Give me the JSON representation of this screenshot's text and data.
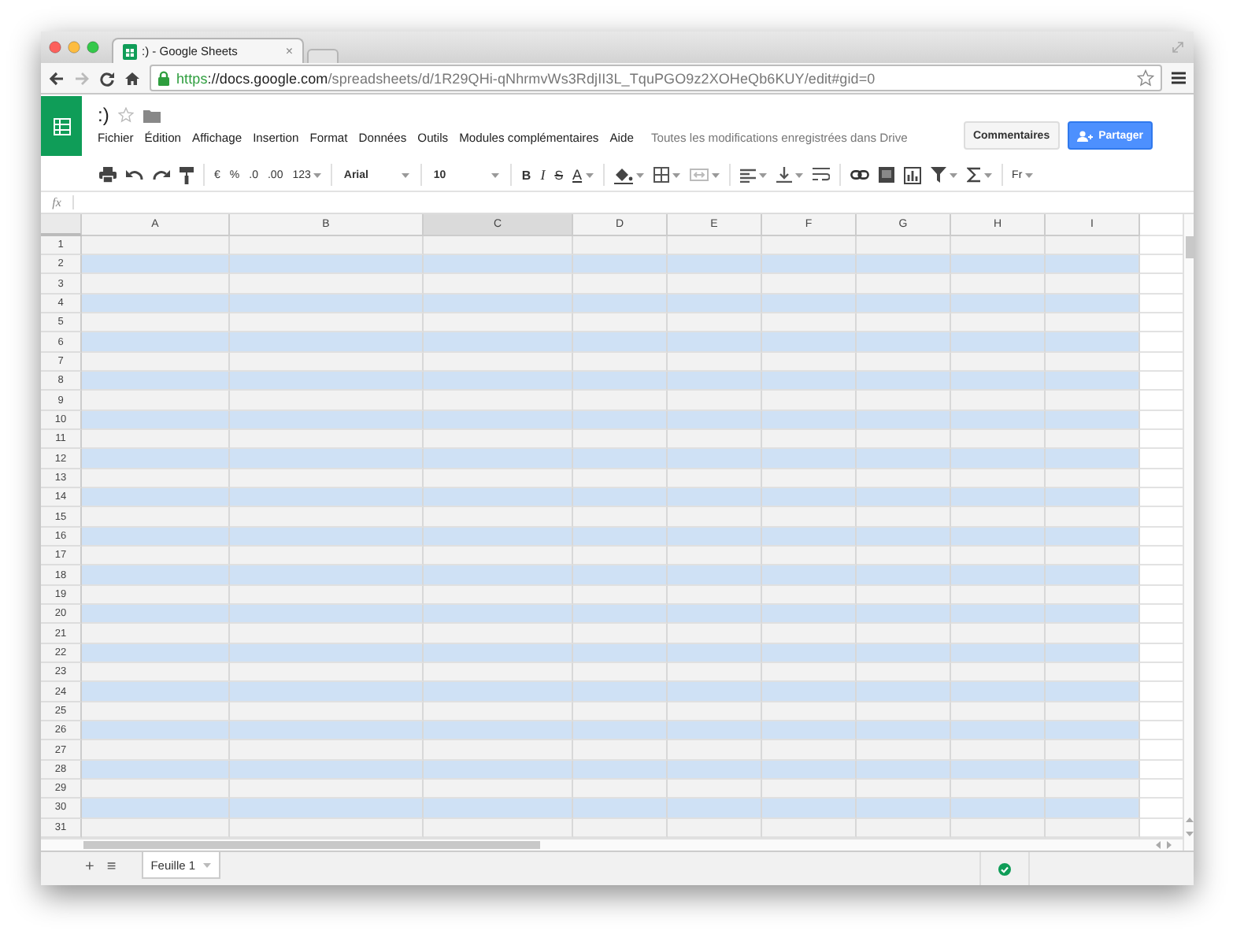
{
  "browser": {
    "tab_title": ":) - Google Sheets",
    "tab_close": "×",
    "url": {
      "scheme": "https",
      "host": "://docs.google.com",
      "path": "/spreadsheets/d/1R29QHi-qNhrmvWs3RdjII3L_TquPGO9z2XOHeQb6KUY/edit#gid=0"
    }
  },
  "document": {
    "title": ":)",
    "starred": false
  },
  "menu": [
    "Fichier",
    "Édition",
    "Affichage",
    "Insertion",
    "Format",
    "Données",
    "Outils",
    "Modules complémentaires",
    "Aide"
  ],
  "save_status": "Toutes les modifications enregistrées dans Drive",
  "buttons": {
    "comments": "Commentaires",
    "share": "Partager"
  },
  "toolbar": [
    {
      "kind": "icon",
      "dropdown": false
    },
    {
      "kind": "icon",
      "dropdown": false
    },
    {
      "kind": "icon",
      "dropdown": false
    },
    {
      "kind": "icon",
      "dropdown": false
    },
    {
      "kind": "sep"
    },
    {
      "kind": "text",
      "label": "€",
      "dropdown": false
    },
    {
      "kind": "text",
      "label": "%",
      "dropdown": false
    },
    {
      "kind": "text",
      "label": ".0",
      "dropdown": false
    },
    {
      "kind": "text",
      "label": ".00",
      "dropdown": false
    },
    {
      "kind": "text",
      "label": "123",
      "dropdown": true
    },
    {
      "kind": "sep"
    },
    {
      "kind": "wide",
      "label": "Arial",
      "dropdown": true
    },
    {
      "kind": "sep"
    },
    {
      "kind": "wide",
      "label": "10",
      "dropdown": true
    },
    {
      "kind": "sep"
    },
    {
      "kind": "bold",
      "label": "B",
      "dropdown": false
    },
    {
      "kind": "italic",
      "label": "I",
      "dropdown": false
    },
    {
      "kind": "strike",
      "label": "S",
      "dropdown": false
    },
    {
      "kind": "textcolor",
      "label": "A",
      "dropdown": true
    },
    {
      "kind": "sep"
    },
    {
      "kind": "icon",
      "dropdown": true
    },
    {
      "kind": "icon",
      "dropdown": true
    },
    {
      "kind": "icon",
      "dropdown": true
    },
    {
      "kind": "sep"
    },
    {
      "kind": "icon",
      "dropdown": true
    },
    {
      "kind": "icon",
      "dropdown": true
    },
    {
      "kind": "icon",
      "dropdown": false
    },
    {
      "kind": "sep"
    },
    {
      "kind": "icon",
      "dropdown": false
    },
    {
      "kind": "icon",
      "dropdown": false
    },
    {
      "kind": "icon",
      "dropdown": false
    },
    {
      "kind": "icon",
      "dropdown": true
    },
    {
      "kind": "icon",
      "dropdown": true
    },
    {
      "kind": "sep"
    },
    {
      "kind": "text",
      "label": "Fr",
      "dropdown": true
    }
  ],
  "formula_bar": {
    "label": "fx"
  },
  "sheet": {
    "columns": [
      {
        "label": "A",
        "selected": false
      },
      {
        "label": "B",
        "selected": false
      },
      {
        "label": "C",
        "selected": true
      },
      {
        "label": "D",
        "selected": false
      },
      {
        "label": "E",
        "selected": false
      },
      {
        "label": "F",
        "selected": false
      },
      {
        "label": "G",
        "selected": false
      },
      {
        "label": "H",
        "selected": false
      },
      {
        "label": "I",
        "selected": false
      }
    ],
    "rows": [
      {
        "label": "1",
        "shaded": false
      },
      {
        "label": "2",
        "shaded": true
      },
      {
        "label": "3",
        "shaded": false
      },
      {
        "label": "4",
        "shaded": true
      },
      {
        "label": "5",
        "shaded": false
      },
      {
        "label": "6",
        "shaded": true
      },
      {
        "label": "7",
        "shaded": false
      },
      {
        "label": "8",
        "shaded": true
      },
      {
        "label": "9",
        "shaded": false
      },
      {
        "label": "10",
        "shaded": true
      },
      {
        "label": "11",
        "shaded": false
      },
      {
        "label": "12",
        "shaded": true
      },
      {
        "label": "13",
        "shaded": false
      },
      {
        "label": "14",
        "shaded": true
      },
      {
        "label": "15",
        "shaded": false
      },
      {
        "label": "16",
        "shaded": true
      },
      {
        "label": "17",
        "shaded": false
      },
      {
        "label": "18",
        "shaded": true
      },
      {
        "label": "19",
        "shaded": false
      },
      {
        "label": "20",
        "shaded": true
      },
      {
        "label": "21",
        "shaded": false
      },
      {
        "label": "22",
        "shaded": true
      },
      {
        "label": "23",
        "shaded": false
      },
      {
        "label": "24",
        "shaded": true
      },
      {
        "label": "25",
        "shaded": false
      },
      {
        "label": "26",
        "shaded": true
      },
      {
        "label": "27",
        "shaded": false
      },
      {
        "label": "28",
        "shaded": true
      },
      {
        "label": "29",
        "shaded": false
      },
      {
        "label": "30",
        "shaded": true
      },
      {
        "label": "31",
        "shaded": false
      }
    ]
  },
  "bottom_bar": {
    "add": "+",
    "list": "≡",
    "sheets": [
      {
        "label": "Feuille 1",
        "selected": true
      }
    ]
  }
}
